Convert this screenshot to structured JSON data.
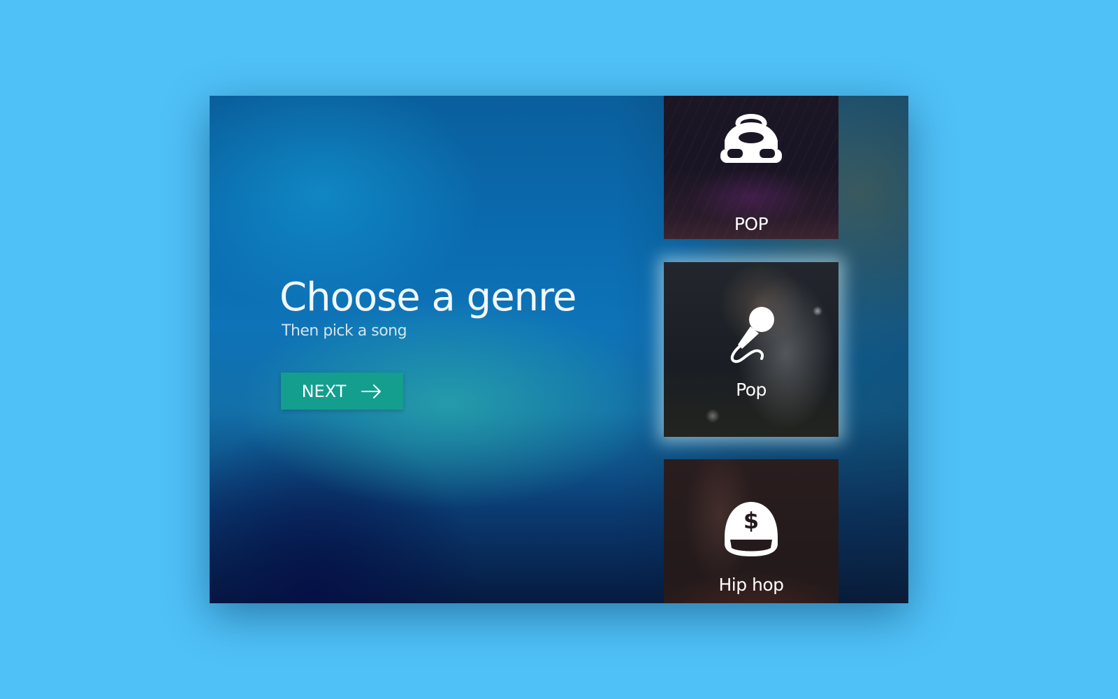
{
  "intro": {
    "title": "Choose a genre",
    "subtitle": "Then pick a song",
    "next_label": "NEXT"
  },
  "genres": [
    {
      "label": "POP",
      "icon": "boombox-icon",
      "selected": false
    },
    {
      "label": "Pop",
      "icon": "microphone-icon",
      "selected": true
    },
    {
      "label": "Hip hop",
      "icon": "cap-dollar-icon",
      "selected": false
    }
  ],
  "colors": {
    "page_background": "#4fc1f7",
    "button_accent": "#139e8e",
    "text": "#ffffff"
  }
}
